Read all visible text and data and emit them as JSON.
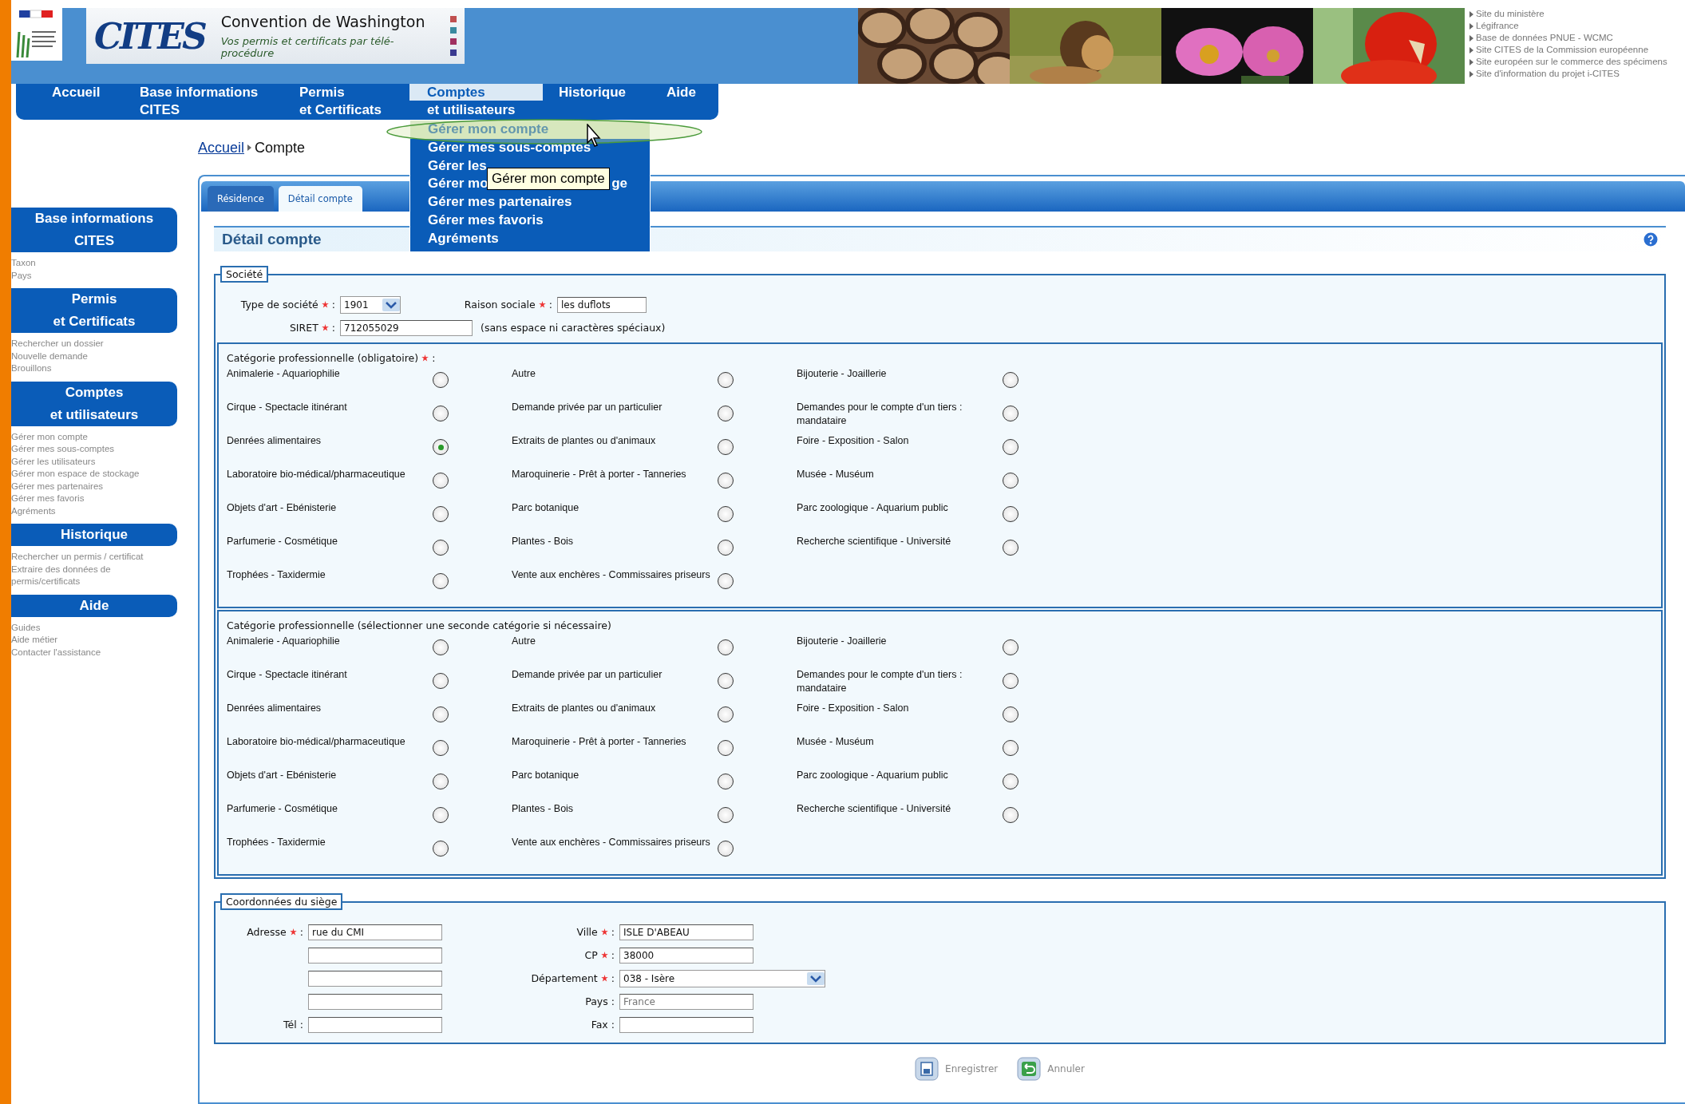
{
  "header": {
    "logo": "CITES",
    "banner_title": "Convention de Washington",
    "banner_subtitle": "Vos permis et certificats par télé-procédure",
    "photos": [
      {
        "kind": "picture"
      },
      {
        "kind": "picture"
      },
      {
        "kind": "picture"
      },
      {
        "kind": "picture"
      }
    ],
    "links": [
      "Site du ministère",
      "Légifrance",
      "Base de données PNUE - WCMC",
      "Site CITES de la Commission européenne",
      "Site européen sur le commerce des spécimens",
      "Site d'information du projet i-CITES"
    ]
  },
  "nav": [
    {
      "lines": [
        "Accueil"
      ],
      "selected": false
    },
    {
      "lines": [
        "Base informations",
        "CITES"
      ],
      "selected": false
    },
    {
      "lines": [
        "Permis",
        "et Certificats"
      ],
      "selected": false
    },
    {
      "lines": [
        "Comptes",
        "et utilisateurs"
      ],
      "selected": true
    },
    {
      "lines": [
        "Historique"
      ],
      "selected": false
    },
    {
      "lines": [
        "Aide"
      ],
      "selected": false
    }
  ],
  "menu": {
    "items": [
      {
        "label": "Gérer mon compte",
        "selected": true
      },
      {
        "label": "Gérer mes sous-comptes",
        "selected": false
      },
      {
        "label": "Gérer les",
        "selected": false
      },
      {
        "label": "Gérer mo",
        "tail": "ge",
        "selected": false
      },
      {
        "label": "Gérer mes partenaires",
        "selected": false
      },
      {
        "label": "Gérer mes favoris",
        "selected": false
      },
      {
        "label": "Agréments",
        "selected": false
      }
    ],
    "tooltip": "Gérer mon compte"
  },
  "breadcrumb": [
    "Accueil",
    "Compte"
  ],
  "sidebar": [
    {
      "title": [
        "Base informations",
        "CITES"
      ],
      "items": [
        "Taxon",
        "Pays"
      ]
    },
    {
      "title": [
        "Permis",
        "et Certificats"
      ],
      "items": [
        "Rechercher un dossier",
        "Nouvelle demande",
        "Brouillons"
      ]
    },
    {
      "title": [
        "Comptes",
        "et utilisateurs"
      ],
      "items": [
        "Gérer mon compte",
        "Gérer mes sous-comptes",
        "Gérer les utilisateurs",
        "Gérer mon espace de stockage",
        "Gérer mes partenaires",
        "Gérer mes favoris",
        "Agréments"
      ]
    },
    {
      "title": [
        "Historique"
      ],
      "items": [
        "Rechercher un permis / certificat",
        "Extraire des données de permis/certificats"
      ]
    },
    {
      "title": [
        "Aide"
      ],
      "items": [
        "Guides",
        "Aide métier",
        "Contacter l'assistance"
      ]
    }
  ],
  "tabs": [
    {
      "label": "Résidence",
      "selected": false
    },
    {
      "label": "Détail compte",
      "selected": true
    }
  ],
  "title": "Détail compte",
  "societe": {
    "legend": "Société",
    "type": {
      "label": "Type de société",
      "required": true,
      "colon": ":",
      "value": "1901"
    },
    "raison": {
      "label": "Raison sociale",
      "required": true,
      "colon": ":",
      "value": "les duflots"
    },
    "siret": {
      "label": "SIRET",
      "required": true,
      "colon": ":",
      "value": "712055029",
      "hint": "(sans espace ni caractères spéciaux)"
    },
    "groups": [
      {
        "label": "Catégorie professionnelle (obligatoire)",
        "required": true,
        "colon": ":",
        "options": [
          {
            "label": "Animalerie - Aquariophilie",
            "selected": false
          },
          {
            "label": "Autre",
            "selected": false
          },
          {
            "label": "Bijouterie - Joaillerie",
            "selected": false
          },
          {
            "label": "Cirque - Spectacle itinérant",
            "selected": false
          },
          {
            "label": "Demande privée par un particulier",
            "selected": false
          },
          {
            "label": "Demandes pour le compte d'un tiers : mandataire",
            "selected": false
          },
          {
            "label": "Denrées alimentaires",
            "selected": true
          },
          {
            "label": "Extraits de plantes ou d'animaux",
            "selected": false
          },
          {
            "label": "Foire - Exposition - Salon",
            "selected": false
          },
          {
            "label": "Laboratoire bio-médical/pharmaceutique",
            "selected": false
          },
          {
            "label": "Maroquinerie - Prêt à porter - Tanneries",
            "selected": false
          },
          {
            "label": "Musée - Muséum",
            "selected": false
          },
          {
            "label": "Objets d'art - Ebénisterie",
            "selected": false
          },
          {
            "label": "Parc botanique",
            "selected": false
          },
          {
            "label": "Parc zoologique - Aquarium public",
            "selected": false
          },
          {
            "label": "Parfumerie - Cosmétique",
            "selected": false
          },
          {
            "label": "Plantes - Bois",
            "selected": false
          },
          {
            "label": "Recherche scientifique - Université",
            "selected": false
          },
          {
            "label": "Trophées - Taxidermie",
            "selected": false
          },
          {
            "label": "Vente aux enchères - Commissaires priseurs",
            "selected": false
          }
        ]
      },
      {
        "label": "Catégorie professionnelle (sélectionner une seconde catégorie si nécessaire)",
        "required": false,
        "options": [
          {
            "label": "Animalerie - Aquariophilie",
            "selected": false
          },
          {
            "label": "Autre",
            "selected": false
          },
          {
            "label": "Bijouterie - Joaillerie",
            "selected": false
          },
          {
            "label": "Cirque - Spectacle itinérant",
            "selected": false
          },
          {
            "label": "Demande privée par un particulier",
            "selected": false
          },
          {
            "label": "Demandes pour le compte d'un tiers : mandataire",
            "selected": false
          },
          {
            "label": "Denrées alimentaires",
            "selected": false
          },
          {
            "label": "Extraits de plantes ou d'animaux",
            "selected": false
          },
          {
            "label": "Foire - Exposition - Salon",
            "selected": false
          },
          {
            "label": "Laboratoire bio-médical/pharmaceutique",
            "selected": false
          },
          {
            "label": "Maroquinerie - Prêt à porter - Tanneries",
            "selected": false
          },
          {
            "label": "Musée - Muséum",
            "selected": false
          },
          {
            "label": "Objets d'art - Ebénisterie",
            "selected": false
          },
          {
            "label": "Parc botanique",
            "selected": false
          },
          {
            "label": "Parc zoologique - Aquarium public",
            "selected": false
          },
          {
            "label": "Parfumerie - Cosmétique",
            "selected": false
          },
          {
            "label": "Plantes - Bois",
            "selected": false
          },
          {
            "label": "Recherche scientifique - Université",
            "selected": false
          },
          {
            "label": "Trophées - Taxidermie",
            "selected": false
          },
          {
            "label": "Vente aux enchères - Commissaires priseurs",
            "selected": false
          }
        ]
      }
    ]
  },
  "siege": {
    "legend": "Coordonnées du siège",
    "left": [
      {
        "kind": "labelled",
        "label": "Adresse",
        "required": true,
        "colon": ":",
        "value": "rue du CMI"
      },
      {
        "kind": "blank"
      },
      {
        "kind": "blank"
      },
      {
        "kind": "blank"
      },
      {
        "kind": "labelled",
        "label": "Tél",
        "required": false,
        "colon": ":"
      }
    ],
    "right": [
      {
        "kind": "input",
        "label": "Ville",
        "required": true,
        "colon": ":",
        "value": "ISLE D'ABEAU"
      },
      {
        "kind": "input",
        "label": "CP",
        "required": true,
        "colon": ":",
        "value": "38000"
      },
      {
        "kind": "select",
        "label": "Département",
        "required": true,
        "colon": ":",
        "value": "038 - Isère"
      },
      {
        "kind": "input",
        "label": "Pays",
        "required": false,
        "colon": ":",
        "placeholder": "France"
      },
      {
        "kind": "input",
        "label": "Fax",
        "required": false,
        "colon": ":"
      }
    ]
  },
  "buttons": [
    {
      "kind": "save",
      "label": "Enregistrer"
    },
    {
      "kind": "cancel",
      "label": "Annuler"
    }
  ]
}
